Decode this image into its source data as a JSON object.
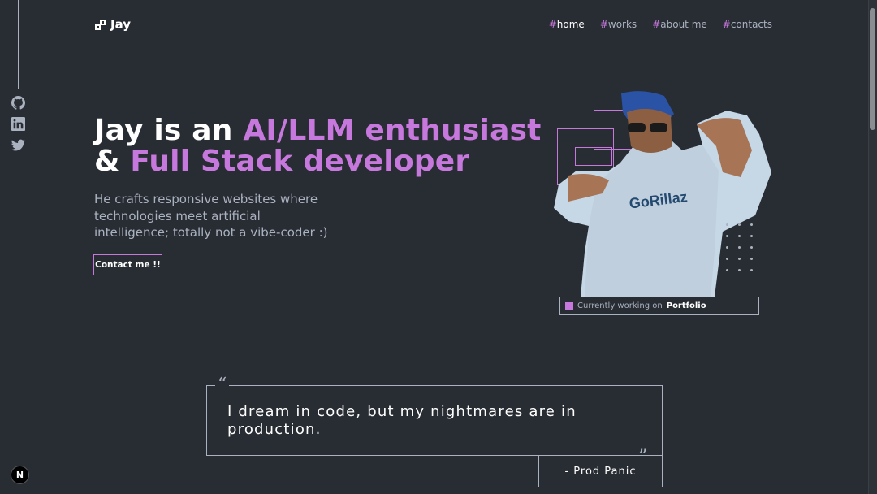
{
  "brand": {
    "name": "Jay"
  },
  "nav": [
    {
      "label": "home",
      "hash": "#",
      "active": true
    },
    {
      "label": "works",
      "hash": "#",
      "active": false
    },
    {
      "label": "about me",
      "hash": "#",
      "active": false
    },
    {
      "label": "contacts",
      "hash": "#",
      "active": false
    }
  ],
  "social": [
    "github-icon",
    "linkedin-icon",
    "twitter-icon"
  ],
  "hero": {
    "line1_prefix": "Jay is an ",
    "line1_accent": "AI/LLM enthusiast",
    "line2_prefix": "& ",
    "line2_accent": "Full Stack developer",
    "description": "He crafts responsive websites where technologies meet artificial intelligence; totally not a vibe-coder :)",
    "cta_label": "Contact me !!"
  },
  "status": {
    "prefix": "Currently working on ",
    "project": "Portfolio"
  },
  "quote": {
    "text": "I dream in code, but my nightmares are in production.",
    "author": "- Prod Panic",
    "open_mark": "“",
    "close_mark": "”"
  },
  "badge": {
    "label": "N"
  },
  "colors": {
    "background": "#282c33",
    "accent": "#c778dd",
    "text": "#ffffff",
    "muted": "#abb2bf"
  }
}
